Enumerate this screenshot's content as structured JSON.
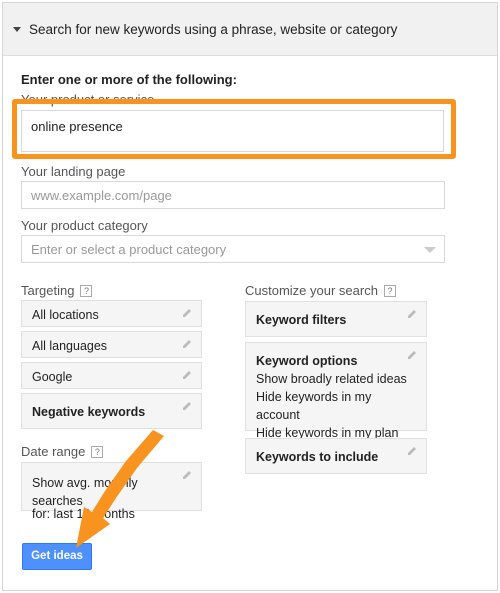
{
  "header": {
    "title": "Search for new keywords using a phrase, website or category"
  },
  "form": {
    "intro": "Enter one or more of the following:",
    "product_label": "Your product or service",
    "product_value": "online presence",
    "landing_label": "Your landing page",
    "landing_placeholder": "www.example.com/page",
    "category_label": "Your product category",
    "category_placeholder": "Enter or select a product category"
  },
  "targeting": {
    "label": "Targeting",
    "help": "?",
    "locations": "All locations",
    "languages": "All languages",
    "network": "Google",
    "negative": "Negative keywords"
  },
  "date_range": {
    "label": "Date range",
    "help": "?",
    "line1": "Show avg. monthly searches",
    "line2": "for: last 12 months"
  },
  "customize": {
    "label": "Customize your search",
    "help": "?",
    "filters": "Keyword filters",
    "options_title": "Keyword options",
    "option1": "Show broadly related ideas",
    "option2": "Hide keywords in my account",
    "option3": "Hide keywords in my plan",
    "include": "Keywords to include"
  },
  "actions": {
    "get_ideas": "Get ideas"
  },
  "colors": {
    "highlight": "#f7931e",
    "button": "#4d90fe"
  }
}
